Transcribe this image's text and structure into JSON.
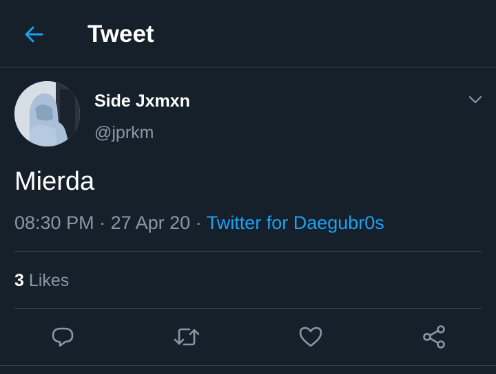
{
  "header": {
    "title": "Tweet",
    "back_icon": "arrow-left-icon"
  },
  "tweet": {
    "author": {
      "display_name": "Side Jxmxn",
      "handle": "@jprkm"
    },
    "text": "Mierda",
    "time": "08:30 PM",
    "separator": " · ",
    "date": "27 Apr 20",
    "source": "Twitter for Daegubr0s",
    "likes": {
      "count": "3",
      "label": "Likes"
    },
    "menu_icon": "chevron-down-icon"
  },
  "actions": [
    {
      "name": "reply",
      "icon": "speech-bubble-icon"
    },
    {
      "name": "retweet",
      "icon": "retweet-icon"
    },
    {
      "name": "like",
      "icon": "heart-icon"
    },
    {
      "name": "share",
      "icon": "share-icon"
    }
  ],
  "colors": {
    "background": "#15202b",
    "accent": "#1da1f2",
    "secondary_text": "#8899a6",
    "divider": "#38444d"
  }
}
